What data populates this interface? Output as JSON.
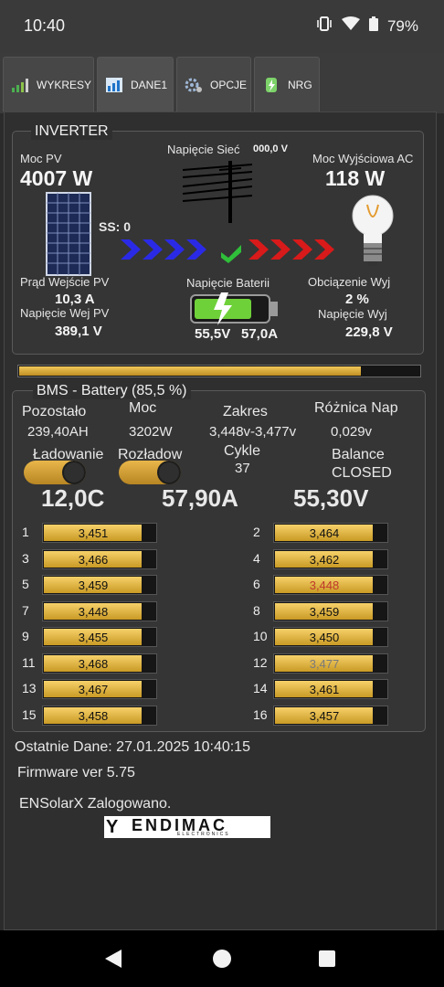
{
  "status_bar": {
    "time": "10:40",
    "battery": "79%"
  },
  "tabs": [
    {
      "label": "WYKRESY"
    },
    {
      "label": "DANE1"
    },
    {
      "label": "OPCJE"
    },
    {
      "label": "NRG"
    }
  ],
  "inverter": {
    "title": "INVERTER",
    "moc_pv_label": "Moc PV",
    "moc_pv_value": "4007 W",
    "napiecie_siec_label": "Napięcie Sieć",
    "napiecie_siec_value": "000,0 V",
    "moc_wyj_label": "Moc Wyjściowa AC",
    "moc_wyj_value": "118 W",
    "ss": "SS: 0",
    "prad_wej_pv_label": "Prąd Wejście PV",
    "prad_wej_pv_value": "10,3 A",
    "napiecie_baterii_label": "Napięcie Baterii",
    "obciazenie_label": "Obciązenie Wyj",
    "obciazenie_value": "2 %",
    "napiecie_wej_pv_label": "Napięcie Wej PV",
    "napiecie_wej_pv_value": "389,1 V",
    "bat_v1": "55,5V",
    "bat_v2": "57,0A",
    "napiecie_wyj_label": "Napięcie Wyj",
    "napiecie_wyj_value": "229,8 V"
  },
  "battery_level": 0.855,
  "bms": {
    "title": "BMS - Battery (85,5 %)",
    "pozostalo_label": "Pozostało",
    "pozostalo_value": "239,40AH",
    "moc_label": "Moc",
    "moc_value": "3202W",
    "zakres_label": "Zakres",
    "zakres_value": "3,448v-3,477v",
    "roznica_label": "Różnica Nap",
    "roznica_value": "0,029v",
    "ladowanie_label": "Ładowanie",
    "rozladow_label": "Rozładow",
    "cykle_label": "Cykle",
    "cykle_value": "37",
    "balance_label": "Balance",
    "balance_value": "CLOSED",
    "temp": "12,0C",
    "current": "57,90A",
    "voltage": "55,30V",
    "cells": [
      {
        "n": "1",
        "v": "3,451",
        "level": 0.88,
        "color": "#111111"
      },
      {
        "n": "2",
        "v": "3,464",
        "level": 0.88,
        "color": "#111111"
      },
      {
        "n": "3",
        "v": "3,466",
        "level": 0.88,
        "color": "#111111"
      },
      {
        "n": "4",
        "v": "3,462",
        "level": 0.88,
        "color": "#111111"
      },
      {
        "n": "5",
        "v": "3,459",
        "level": 0.88,
        "color": "#111111"
      },
      {
        "n": "6",
        "v": "3,448",
        "level": 0.88,
        "color": "#c0392b"
      },
      {
        "n": "7",
        "v": "3,448",
        "level": 0.88,
        "color": "#111111"
      },
      {
        "n": "8",
        "v": "3,459",
        "level": 0.88,
        "color": "#111111"
      },
      {
        "n": "9",
        "v": "3,455",
        "level": 0.88,
        "color": "#111111"
      },
      {
        "n": "10",
        "v": "3,450",
        "level": 0.88,
        "color": "#111111"
      },
      {
        "n": "11",
        "v": "3,468",
        "level": 0.88,
        "color": "#111111"
      },
      {
        "n": "12",
        "v": "3,477",
        "level": 0.88,
        "color": "#7a7a7a"
      },
      {
        "n": "13",
        "v": "3,467",
        "level": 0.88,
        "color": "#111111"
      },
      {
        "n": "14",
        "v": "3,461",
        "level": 0.88,
        "color": "#111111"
      },
      {
        "n": "15",
        "v": "3,458",
        "level": 0.88,
        "color": "#111111"
      },
      {
        "n": "16",
        "v": "3,457",
        "level": 0.88,
        "color": "#111111"
      }
    ]
  },
  "footer": {
    "ostatnie": "Ostatnie Dane: 27.01.2025 10:40:15",
    "firmware": "Firmware ver 5.75",
    "login": "ENSolarX Zalogowano.",
    "logo_text": "ENDIMAC",
    "logo_sub": "ELECTRONICS"
  },
  "colors": {
    "accent": "#e3b341",
    "left_arrows": "#2a2ae6",
    "right_arrows": "#d81a1a",
    "check": "#2fbf3a"
  }
}
